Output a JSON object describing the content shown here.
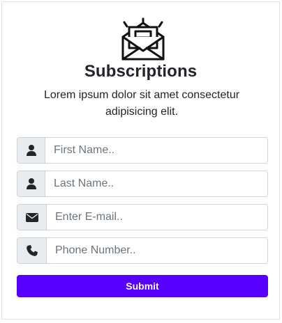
{
  "header": {
    "icon": "open-envelope-newsletter-icon",
    "title": "Subscriptions",
    "description": "Lorem ipsum dolor sit amet consectetur adipisicing elit."
  },
  "form": {
    "fields": [
      {
        "icon": "user-icon",
        "placeholder": "First Name..",
        "value": ""
      },
      {
        "icon": "user-icon",
        "placeholder": "Last Name..",
        "value": ""
      },
      {
        "icon": "envelope-icon",
        "placeholder": "Enter E-mail..",
        "value": ""
      },
      {
        "icon": "phone-icon",
        "placeholder": "Phone Number..",
        "value": ""
      }
    ],
    "submit_label": "Submit"
  },
  "colors": {
    "accent": "#5500ff",
    "addon_bg": "#e9ecef",
    "border": "#ced4da",
    "text": "#212529"
  }
}
